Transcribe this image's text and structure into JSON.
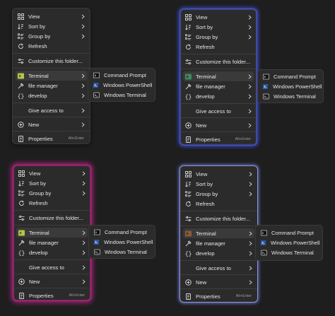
{
  "menu": {
    "items": {
      "view": "View",
      "sort_by": "Sort by",
      "group_by": "Group by",
      "refresh": "Refresh",
      "customize": "Customize this folder...",
      "terminal": "Terminal",
      "file_manager": "file manager",
      "develop": "develop",
      "give_access": "Give access to",
      "new": "New",
      "properties": "Properties",
      "properties_shortcut": "Alt+Enter"
    }
  },
  "submenu": {
    "items": {
      "command_prompt": "Command Prompt",
      "powershell": "Windows PowerShell",
      "windows_terminal": "Windows Terminal"
    }
  },
  "variants": [
    "plain",
    "blue-glow",
    "magenta-glow",
    "lavender-glow"
  ],
  "colors": {
    "background": "#1e1e1e",
    "menu_bg": "#2b2b2b",
    "text": "#e6e6e6",
    "blue_glow": "#3b4fd8",
    "magenta_glow": "#b2227f",
    "lavender_glow": "#8a93d6",
    "terminal_icon": "#c8d35a"
  }
}
